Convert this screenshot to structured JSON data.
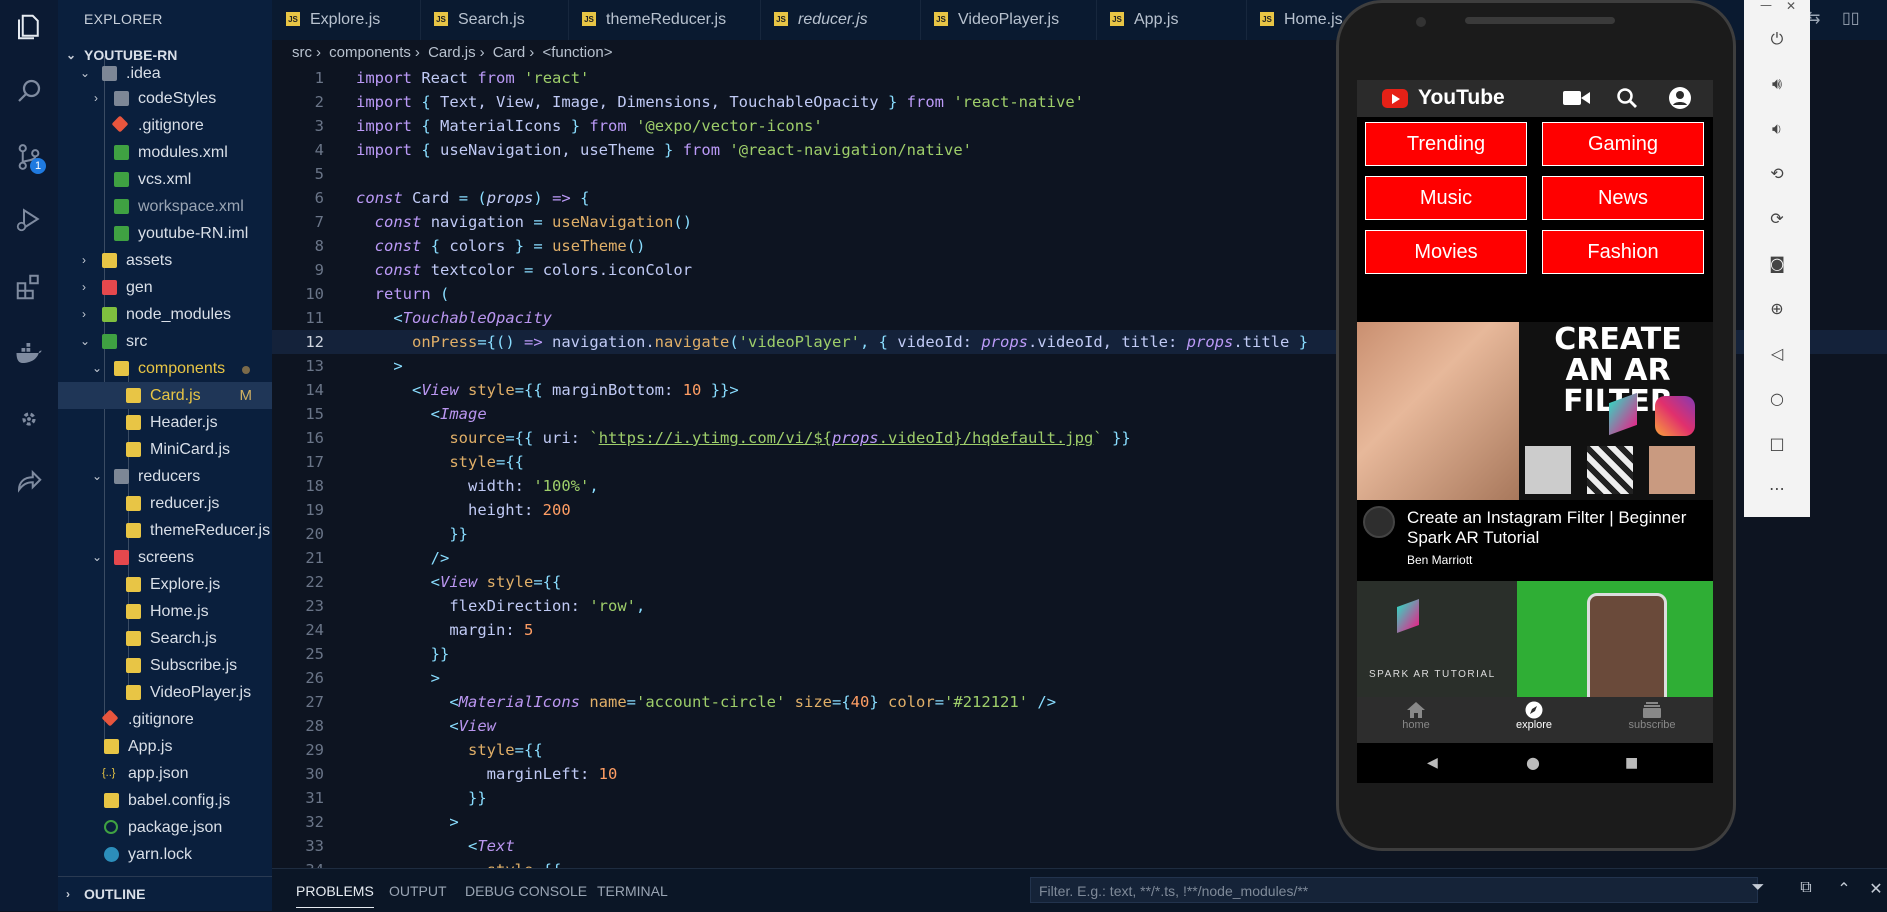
{
  "activity_bar": {
    "scm_badge": "1"
  },
  "sidebar": {
    "title": "EXPLORER",
    "root": "YOUTUBE-RN",
    "outline": "OUTLINE",
    "items": [
      {
        "label": ".idea",
        "type": "folder-open"
      },
      {
        "label": "codeStyles",
        "type": "folder"
      },
      {
        "label": ".gitignore",
        "type": "git"
      },
      {
        "label": "modules.xml",
        "type": "xml"
      },
      {
        "label": "vcs.xml",
        "type": "xml"
      },
      {
        "label": "workspace.xml",
        "type": "xml"
      },
      {
        "label": "youtube-RN.iml",
        "type": "xml"
      },
      {
        "label": "assets",
        "type": "folder"
      },
      {
        "label": "gen",
        "type": "folder"
      },
      {
        "label": "node_modules",
        "type": "folder"
      },
      {
        "label": "src",
        "type": "folder-open"
      },
      {
        "label": "components",
        "type": "folder-open"
      },
      {
        "label": "Card.js",
        "type": "js",
        "status": "M"
      },
      {
        "label": "Header.js",
        "type": "js"
      },
      {
        "label": "MiniCard.js",
        "type": "js"
      },
      {
        "label": "reducers",
        "type": "folder-open"
      },
      {
        "label": "reducer.js",
        "type": "js"
      },
      {
        "label": "themeReducer.js",
        "type": "js"
      },
      {
        "label": "screens",
        "type": "folder-open"
      },
      {
        "label": "Explore.js",
        "type": "js"
      },
      {
        "label": "Home.js",
        "type": "js"
      },
      {
        "label": "Search.js",
        "type": "js"
      },
      {
        "label": "Subscribe.js",
        "type": "js"
      },
      {
        "label": "VideoPlayer.js",
        "type": "js"
      },
      {
        "label": ".gitignore",
        "type": "git"
      },
      {
        "label": "App.js",
        "type": "js"
      },
      {
        "label": "app.json",
        "type": "json"
      },
      {
        "label": "babel.config.js",
        "type": "js"
      },
      {
        "label": "package.json",
        "type": "json"
      },
      {
        "label": "yarn.lock",
        "type": "yarn"
      }
    ]
  },
  "tabs": [
    "Explore.js",
    "Search.js",
    "themeReducer.js",
    "reducer.js",
    "VideoPlayer.js",
    "App.js",
    "Home.js"
  ],
  "breadcrumb": [
    "src",
    "components",
    "Card.js",
    "Card",
    "<function>"
  ],
  "editor": {
    "current_line": 12
  },
  "panel": {
    "tabs": [
      "PROBLEMS",
      "OUTPUT",
      "DEBUG CONSOLE",
      "TERMINAL"
    ],
    "filter_placeholder": "Filter. E.g.: text, **/*.ts, !**/node_modules/**"
  },
  "emulator": {
    "app_title": "YouTube",
    "categories": [
      "Trending",
      "Gaming",
      "Music",
      "News",
      "Movies",
      "Fashion"
    ],
    "video": {
      "thumb_text": "CREATE AN AR FILTER",
      "title": "Create an Instagram Filter | Beginner Spark AR Tutorial",
      "channel": "Ben Marriott"
    },
    "video2_label": "SPARK AR TUTORIAL",
    "tabbar": [
      "home",
      "explore",
      "subscribe"
    ],
    "active_tab": "explore"
  },
  "colors": {
    "accent": "#ff0000",
    "sidebar_bg": "#0a1f3d",
    "editor_bg": "#0d1421"
  }
}
